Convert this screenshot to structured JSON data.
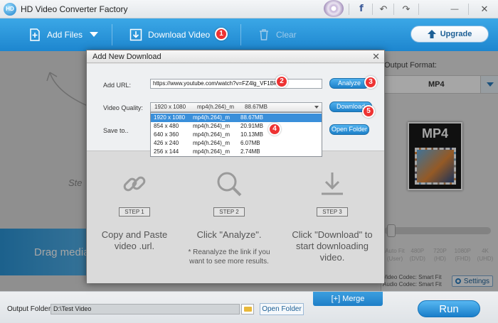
{
  "window": {
    "title": "HD Video Converter Factory",
    "logo": "HD"
  },
  "toolbar": {
    "add_files": "Add Files",
    "download_video": "Download Video",
    "clear": "Clear",
    "upgrade": "Upgrade"
  },
  "main": {
    "drag_text": "Drag media",
    "step_hint": "Ste"
  },
  "right_panel": {
    "output_format_label": "Output Format:",
    "format_value": "MP4",
    "thumb_label": "MP4",
    "resolutions": [
      "Auto Fit (User)",
      "480P (DVD)",
      "720P (HD)",
      "1080P (FHD)",
      "4K (UHD)"
    ],
    "video_codec": "Video Codec: Smart Fit",
    "audio_codec": "Audio Codec: Smart Fit",
    "settings": "Settings"
  },
  "bottom": {
    "output_folder_label": "Output Folder:",
    "output_path": "D:\\Test Video",
    "open_folder": "Open Folder",
    "merge": "Merge",
    "run": "Run"
  },
  "dialog": {
    "title": "Add New Download",
    "add_url_label": "Add URL:",
    "url_value": "https://www.youtube.com/watch?v=FZ4lg_VF1Bk",
    "analyze": "Analyze",
    "video_quality_label": "Video Quality:",
    "selected": {
      "res": "1920 x 1080",
      "fmt": "mp4(h.264)_m",
      "size": "88.67MB"
    },
    "options": [
      {
        "res": "1920 x 1080",
        "fmt": "mp4(h.264)_m",
        "size": "88.67MB"
      },
      {
        "res": "854 x 480",
        "fmt": "mp4(h.264)_m",
        "size": "20.91MB"
      },
      {
        "res": "640 x 360",
        "fmt": "mp4(h.264)_m",
        "size": "10.13MB"
      },
      {
        "res": "426 x 240",
        "fmt": "mp4(h.264)_m",
        "size": "6.07MB"
      },
      {
        "res": "256 x 144",
        "fmt": "mp4(h.264)_m",
        "size": "2.74MB"
      }
    ],
    "download": "Download",
    "save_to_label": "Save to..",
    "open_folder": "Open Folder",
    "steps": [
      {
        "tag": "STEP 1",
        "desc": "Copy and Paste video .url.",
        "note": ""
      },
      {
        "tag": "STEP 2",
        "desc": "Click \"Analyze\".",
        "note": "* Reanalyze the link if you want to see more results."
      },
      {
        "tag": "STEP 3",
        "desc": "Click \"Download\" to start downloading video.",
        "note": ""
      }
    ]
  },
  "badges": [
    "1",
    "2",
    "3",
    "4",
    "5"
  ],
  "icons": {
    "facebook": "f",
    "undo": "↶",
    "redo": "↷",
    "minimize": "—",
    "close": "✕",
    "dialog_close": "✕",
    "merge": "[+]"
  },
  "colors": {
    "toolbar": "#1d86cf",
    "badge": "#ee3333",
    "button": "#1d80c9",
    "dropdown_selected": "#3a8fda"
  }
}
